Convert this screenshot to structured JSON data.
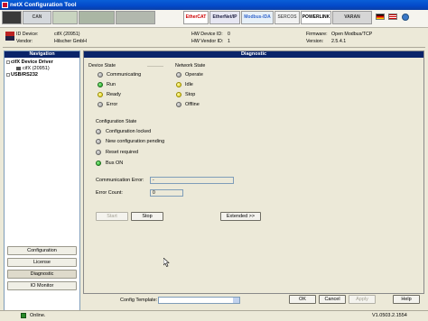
{
  "window": {
    "title": "netX Configuration Tool"
  },
  "toolbar": {
    "logos": [
      "",
      "CAN",
      "",
      "",
      "EtherCAT",
      "EtherNet/IP",
      "Modbus-IDA",
      "SERCOS",
      "POWERLINK",
      "VARAN"
    ],
    "flags": [
      "de-flag-icon",
      "us-flag-icon"
    ]
  },
  "device_info": {
    "vendor_logo": "hilscher-logo",
    "id_device_label": "ID Device:",
    "id_device_value": "cifX (20951)",
    "vendor_label": "Vendor:",
    "vendor_value": "Hilscher GmbH",
    "hw_device_id_label": "HW Device ID:",
    "hw_device_id_value": "0",
    "hw_vendor_id_label": "HW Vendor ID:",
    "hw_vendor_id_value": "1",
    "firmware_label": "Firmware:",
    "firmware_value": "Open Modbus/TCP",
    "version_label": "Version:",
    "version_value": "2.5.4.1"
  },
  "navigation": {
    "title": "Navigation",
    "tree": [
      {
        "label": "cifX Device Driver",
        "level": 0
      },
      {
        "label": "cifX (20951)",
        "level": 1
      },
      {
        "label": "USB/RS232",
        "level": 0
      }
    ],
    "buttons": [
      "Configuration",
      "License",
      "Diagnostic",
      "IO Monitor"
    ],
    "active_button": "Diagnostic"
  },
  "diagnostic": {
    "title": "Diagnostic",
    "device_state_title": "Device State",
    "device_state": [
      {
        "label": "Communicating",
        "led": "gray"
      },
      {
        "label": "Run",
        "led": "green"
      },
      {
        "label": "Ready",
        "led": "yellow"
      },
      {
        "label": "Error",
        "led": "gray"
      }
    ],
    "network_state_title": "Network State",
    "network_state": [
      {
        "label": "Operate",
        "led": "gray"
      },
      {
        "label": "Idle",
        "led": "yellow"
      },
      {
        "label": "Stop",
        "led": "yellow"
      },
      {
        "label": "Offline",
        "led": "gray"
      }
    ],
    "config_state_title": "Configuration State",
    "config_state": [
      {
        "label": "Configuration locked",
        "led": "gray"
      },
      {
        "label": "New configuration pending",
        "led": "gray"
      },
      {
        "label": "Reset required",
        "led": "gray"
      },
      {
        "label": "Bus ON",
        "led": "green"
      }
    ],
    "comm_error_label": "Communication Error:",
    "comm_error_value": "-",
    "error_count_label": "Error Count:",
    "error_count_value": "0",
    "start_label": "Start",
    "stop_label": "Stop",
    "extended_label": "Extended >>"
  },
  "bottom": {
    "config_template_label": "Config Template:",
    "config_template_value": "",
    "ok_label": "OK",
    "cancel_label": "Cancel",
    "apply_label": "Apply",
    "help_label": "Help"
  },
  "status": {
    "text": "Online.",
    "version": "V1.0503.2.1554"
  },
  "colors": {
    "titlebar": "#0349c9",
    "panel_header": "#0a246a",
    "led_green": "#0a9a0a",
    "led_yellow": "#d9c400"
  }
}
